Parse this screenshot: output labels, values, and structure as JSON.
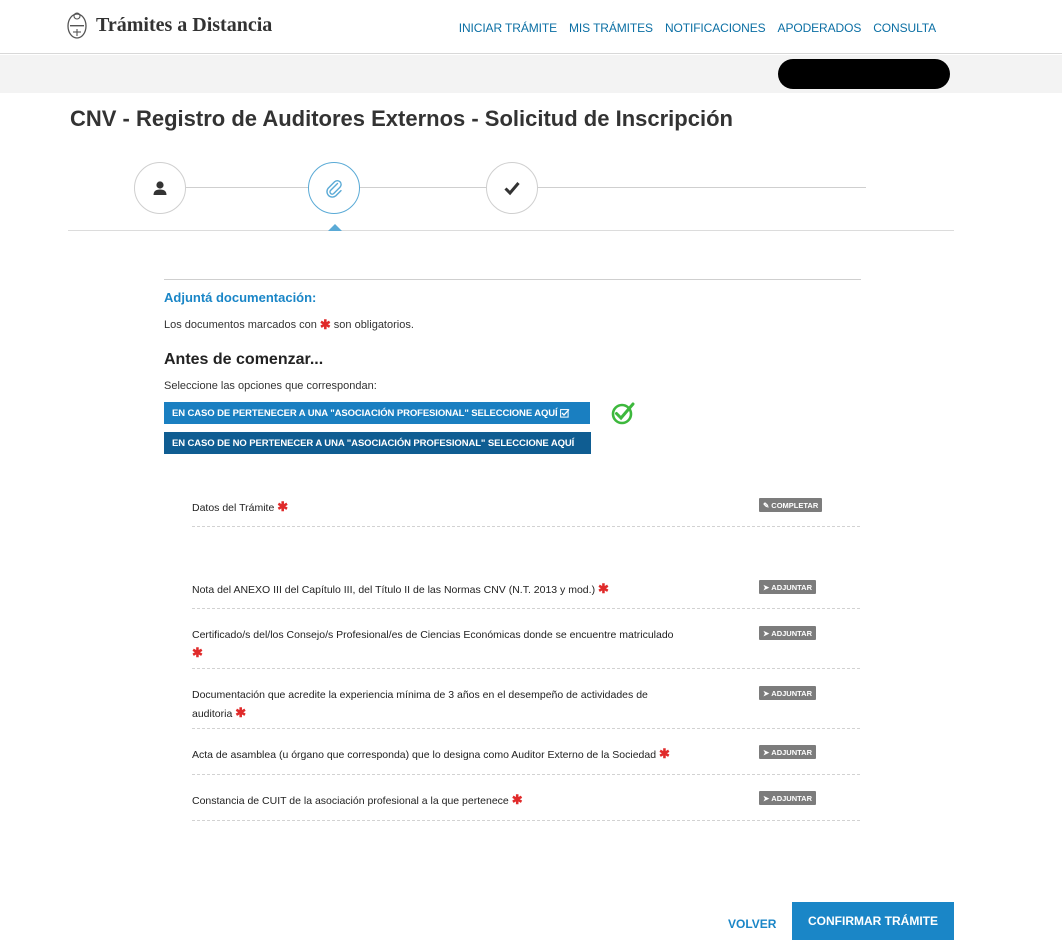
{
  "header": {
    "brand": "Trámites a Distancia",
    "nav": [
      "INICIAR TRÁMITE",
      "MIS TRÁMITES",
      "NOTIFICACIONES",
      "APODERADOS",
      "CONSULTA"
    ]
  },
  "page": {
    "title": "CNV - Registro de Auditores Externos - Solicitud de Inscripción"
  },
  "steps": [
    {
      "icon": "user-icon",
      "state": "done"
    },
    {
      "icon": "paperclip-icon",
      "state": "active"
    },
    {
      "icon": "check-icon",
      "state": "pending"
    }
  ],
  "attach": {
    "title": "Adjuntá documentación:",
    "note_before": "Los documentos marcados con",
    "note_after": "son obligatorios."
  },
  "before": {
    "title": "Antes de comenzar...",
    "select_note": "Seleccione las opciones que correspondan:",
    "option1": "EN CASO DE PERTENECER A UNA \"ASOCIACIÓN PROFESIONAL\" SELECCIONE AQUÍ",
    "option2": "EN CASO DE NO PERTENECER A UNA \"ASOCIACIÓN PROFESIONAL\" SELECCIONE AQUÍ"
  },
  "documents": [
    {
      "label": "Datos del Trámite",
      "button": "COMPLETAR",
      "icon": "pencil-icon"
    },
    {
      "label": "Nota del ANEXO III del Capítulo III, del Título II de las Normas CNV (N.T. 2013 y mod.)",
      "button": "ADJUNTAR",
      "icon": "tag-icon"
    },
    {
      "label": "Certificado/s del/los Consejo/s Profesional/es de Ciencias Económicas donde se encuentre matriculado",
      "button": "ADJUNTAR",
      "icon": "tag-icon"
    },
    {
      "label": "Documentación que acredite la experiencia mínima de 3 años en el desempeño de actividades de auditoria",
      "button": "ADJUNTAR",
      "icon": "tag-icon"
    },
    {
      "label": "Acta de asamblea (u órgano que corresponda) que lo designa como Auditor Externo de la Sociedad",
      "button": "ADJUNTAR",
      "icon": "tag-icon"
    },
    {
      "label": "Constancia de CUIT de la asociación profesional a la que pertenece",
      "button": "ADJUNTAR",
      "icon": "tag-icon"
    }
  ],
  "footer": {
    "back": "VOLVER",
    "confirm": "CONFIRMAR TRÁMITE"
  },
  "colors": {
    "accent": "#1a86c7",
    "required": "#e02a2a",
    "success": "#3db83d"
  }
}
